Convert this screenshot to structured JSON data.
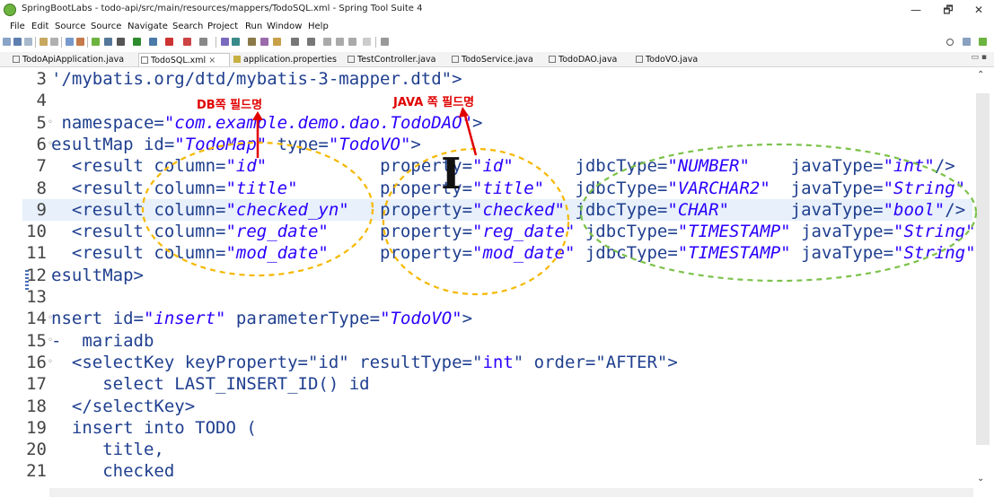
{
  "window": {
    "title": "SpringBootLabs - todo-api/src/main/resources/mappers/TodoSQL.xml - Spring Tool Suite 4",
    "controls": [
      "—",
      "🗗",
      "✕"
    ]
  },
  "menu": [
    "File",
    "Edit",
    "Source",
    "Source",
    "Navigate",
    "Search",
    "Project",
    "Run",
    "Window",
    "Help"
  ],
  "tabs": [
    {
      "label": "TodoApiApplication.java",
      "active": false
    },
    {
      "label": "TodoSQL.xml",
      "active": true,
      "close": "×"
    },
    {
      "label": "application.properties",
      "active": false
    },
    {
      "label": "TestController.java",
      "active": false
    },
    {
      "label": "TodoService.java",
      "active": false
    },
    {
      "label": "TodoDAO.java",
      "active": false
    },
    {
      "label": "TodoVO.java",
      "active": false
    }
  ],
  "editor": {
    "lines": [
      {
        "n": "3",
        "segs": [
          [
            "t",
            "'/mybatis.org/dtd/mybatis-3-mapper.dtd\">"
          ]
        ]
      },
      {
        "n": "4",
        "segs": [
          [
            "t",
            ""
          ]
        ]
      },
      {
        "n": "5",
        "fold": "◦",
        "segs": [
          [
            "t",
            " namespace="
          ],
          [
            "v",
            "\"com.example.demo.dao.TodoDAO\""
          ],
          [
            "t",
            ">"
          ]
        ]
      },
      {
        "n": "6",
        "fold": "◦",
        "segs": [
          [
            "t",
            "esultMap id="
          ],
          [
            "v",
            "\"TodoMap\""
          ],
          [
            "t",
            " type="
          ],
          [
            "v",
            "\"TodoVO\""
          ],
          [
            "t",
            ">"
          ]
        ]
      },
      {
        "n": "7",
        "segs": [
          [
            "t",
            "  <result column="
          ],
          [
            "v",
            "\"id\""
          ],
          [
            "t",
            "           property="
          ],
          [
            "v",
            "\"id\""
          ],
          [
            "t",
            "      jdbcType="
          ],
          [
            "v",
            "\"NUMBER\""
          ],
          [
            "t",
            "    javaType="
          ],
          [
            "v",
            "\"int\""
          ],
          [
            "t",
            "/>"
          ]
        ]
      },
      {
        "n": "8",
        "segs": [
          [
            "t",
            "  <result column="
          ],
          [
            "v",
            "\"title\""
          ],
          [
            "t",
            "        property="
          ],
          [
            "v",
            "\"title\""
          ],
          [
            "t",
            "   jdbcType="
          ],
          [
            "v",
            "\"VARCHAR2\""
          ],
          [
            "t",
            "  javaType="
          ],
          [
            "v",
            "\"String\""
          ]
        ]
      },
      {
        "n": "9",
        "current": true,
        "segs": [
          [
            "t",
            "  <result column="
          ],
          [
            "v",
            "\"checked_yn\""
          ],
          [
            "t",
            "   property="
          ],
          [
            "v",
            "\"checked\""
          ],
          [
            "t",
            " jdbcType="
          ],
          [
            "v",
            "\"CHAR\""
          ],
          [
            "t",
            "      javaType="
          ],
          [
            "v",
            "\"bool\""
          ],
          [
            "t",
            "/>"
          ]
        ]
      },
      {
        "n": "10",
        "segs": [
          [
            "t",
            "  <result column="
          ],
          [
            "v",
            "\"reg_date\""
          ],
          [
            "t",
            "     property="
          ],
          [
            "v",
            "\"reg_date\""
          ],
          [
            "t",
            " jdbcType="
          ],
          [
            "v",
            "\"TIMESTAMP\""
          ],
          [
            "t",
            " javaType="
          ],
          [
            "v",
            "\"String\""
          ]
        ]
      },
      {
        "n": "11",
        "segs": [
          [
            "t",
            "  <result column="
          ],
          [
            "v",
            "\"mod_date\""
          ],
          [
            "t",
            "     property="
          ],
          [
            "v",
            "\"mod_date\""
          ],
          [
            "t",
            " jdbcType="
          ],
          [
            "v",
            "\"TIMESTAMP\""
          ],
          [
            "t",
            " javaType="
          ],
          [
            "v",
            "\"String\""
          ]
        ]
      },
      {
        "n": "12",
        "segs": [
          [
            "t",
            "esultMap>"
          ]
        ]
      },
      {
        "n": "13",
        "segs": [
          [
            "t",
            ""
          ]
        ]
      },
      {
        "n": "14",
        "fold": "◦",
        "segs": [
          [
            "t",
            "nsert id="
          ],
          [
            "v",
            "\"insert\""
          ],
          [
            "t",
            " parameterType="
          ],
          [
            "v",
            "\"TodoVO\""
          ],
          [
            "t",
            ">"
          ]
        ]
      },
      {
        "n": "15",
        "fold": "◦",
        "segs": [
          [
            "t",
            "-  mariadb"
          ]
        ]
      },
      {
        "n": "16",
        "fold": "◦",
        "segs": [
          [
            "t",
            "  <selectKey keyProperty=\"id\" resultType=\""
          ],
          [
            "v2",
            "int"
          ],
          [
            "t",
            "\" order=\"AFTER\">"
          ]
        ]
      },
      {
        "n": "17",
        "segs": [
          [
            "t",
            "     select LAST_INSERT_ID() id"
          ]
        ]
      },
      {
        "n": "18",
        "segs": [
          [
            "t",
            "  </selectKey>"
          ]
        ]
      },
      {
        "n": "19",
        "segs": [
          [
            "t",
            "  insert into TODO ("
          ]
        ]
      },
      {
        "n": "20",
        "segs": [
          [
            "t",
            "     title,"
          ]
        ]
      },
      {
        "n": "21",
        "segs": [
          [
            "t",
            "     checked"
          ]
        ]
      }
    ]
  },
  "annotations": {
    "db_label": "DB쪽 필드명",
    "java_label": "JAVA 쪽 필드명",
    "colors": {
      "red": "#e00000",
      "orange": "#f5b800",
      "green": "#7cc24a"
    }
  }
}
